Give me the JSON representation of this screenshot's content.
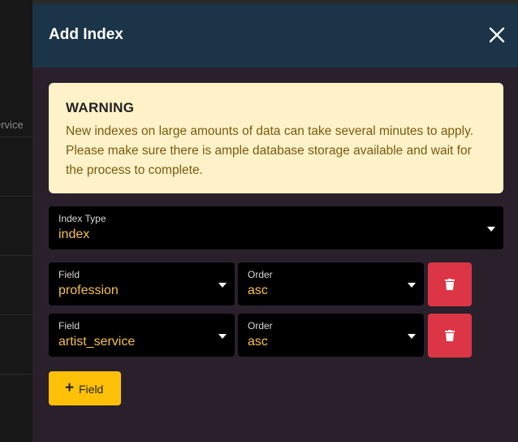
{
  "background": {
    "partial_column_text": "ervice"
  },
  "modal": {
    "title": "Add Index",
    "close_icon": "close-icon"
  },
  "warning": {
    "title": "WARNING",
    "body": "New indexes on large amounts of data can take several minutes to apply. Please make sure there is ample database storage available and wait for the process to complete."
  },
  "index_type": {
    "label": "Index Type",
    "value": "index"
  },
  "fields": [
    {
      "field_label": "Field",
      "field_value": "profession",
      "order_label": "Order",
      "order_value": "asc"
    },
    {
      "field_label": "Field",
      "field_value": "artist_service",
      "order_label": "Order",
      "order_value": "asc"
    }
  ],
  "add_field": {
    "icon": "plus-icon",
    "label": "Field"
  },
  "colors": {
    "header_bg": "#1b3448",
    "modal_bg": "#2a202c",
    "warning_bg": "#fff2c8",
    "value_text": "#f5c04a",
    "delete_button": "#dc3545",
    "add_button": "#ffc107"
  }
}
